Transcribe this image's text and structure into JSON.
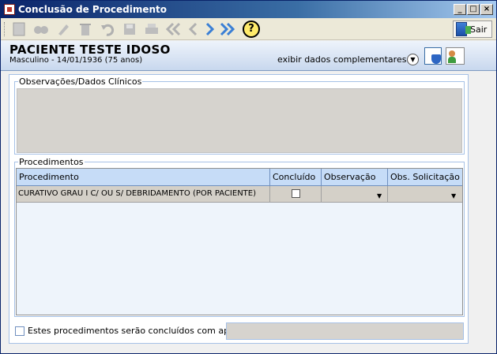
{
  "window": {
    "title": "Conclusão de Procedimento",
    "controls": [
      "_",
      "□",
      "×"
    ]
  },
  "toolbar": {
    "exit_label": "Sair",
    "help_label": "?",
    "icons": [
      "new-icon",
      "search-icon",
      "edit-icon",
      "delete-icon",
      "undo-icon",
      "save-icon",
      "print-icon",
      "first-icon",
      "prev-icon",
      "next-icon",
      "last-icon",
      "help-icon",
      "exit-icon"
    ]
  },
  "patient": {
    "name": "PACIENTE TESTE IDOSO",
    "info": "Masculino - 14/01/1936 (75 anos)",
    "more_label": "exibir dados complementares..."
  },
  "observations": {
    "legend": "Observações/Dados Clínicos"
  },
  "procedures": {
    "legend": "Procedimentos",
    "columns": [
      "Procedimento",
      "Concluído",
      "Observação",
      "Obs. Solicitação"
    ],
    "rows": [
      {
        "procedure": "CURATIVO GRAU I C/ OU S/ DEBRIDAMENTO (POR PACIENTE)",
        "concluded": false,
        "observation": "",
        "obs_request": ""
      }
    ]
  },
  "footer": {
    "apoio_label": "Estes procedimentos serão concluídos com apoio"
  },
  "colors": {
    "titlebar": "#0a246a",
    "header_bg": "#c8d8ee",
    "grid_header": "#c6dcf7",
    "accent": "#3a7fd5"
  }
}
